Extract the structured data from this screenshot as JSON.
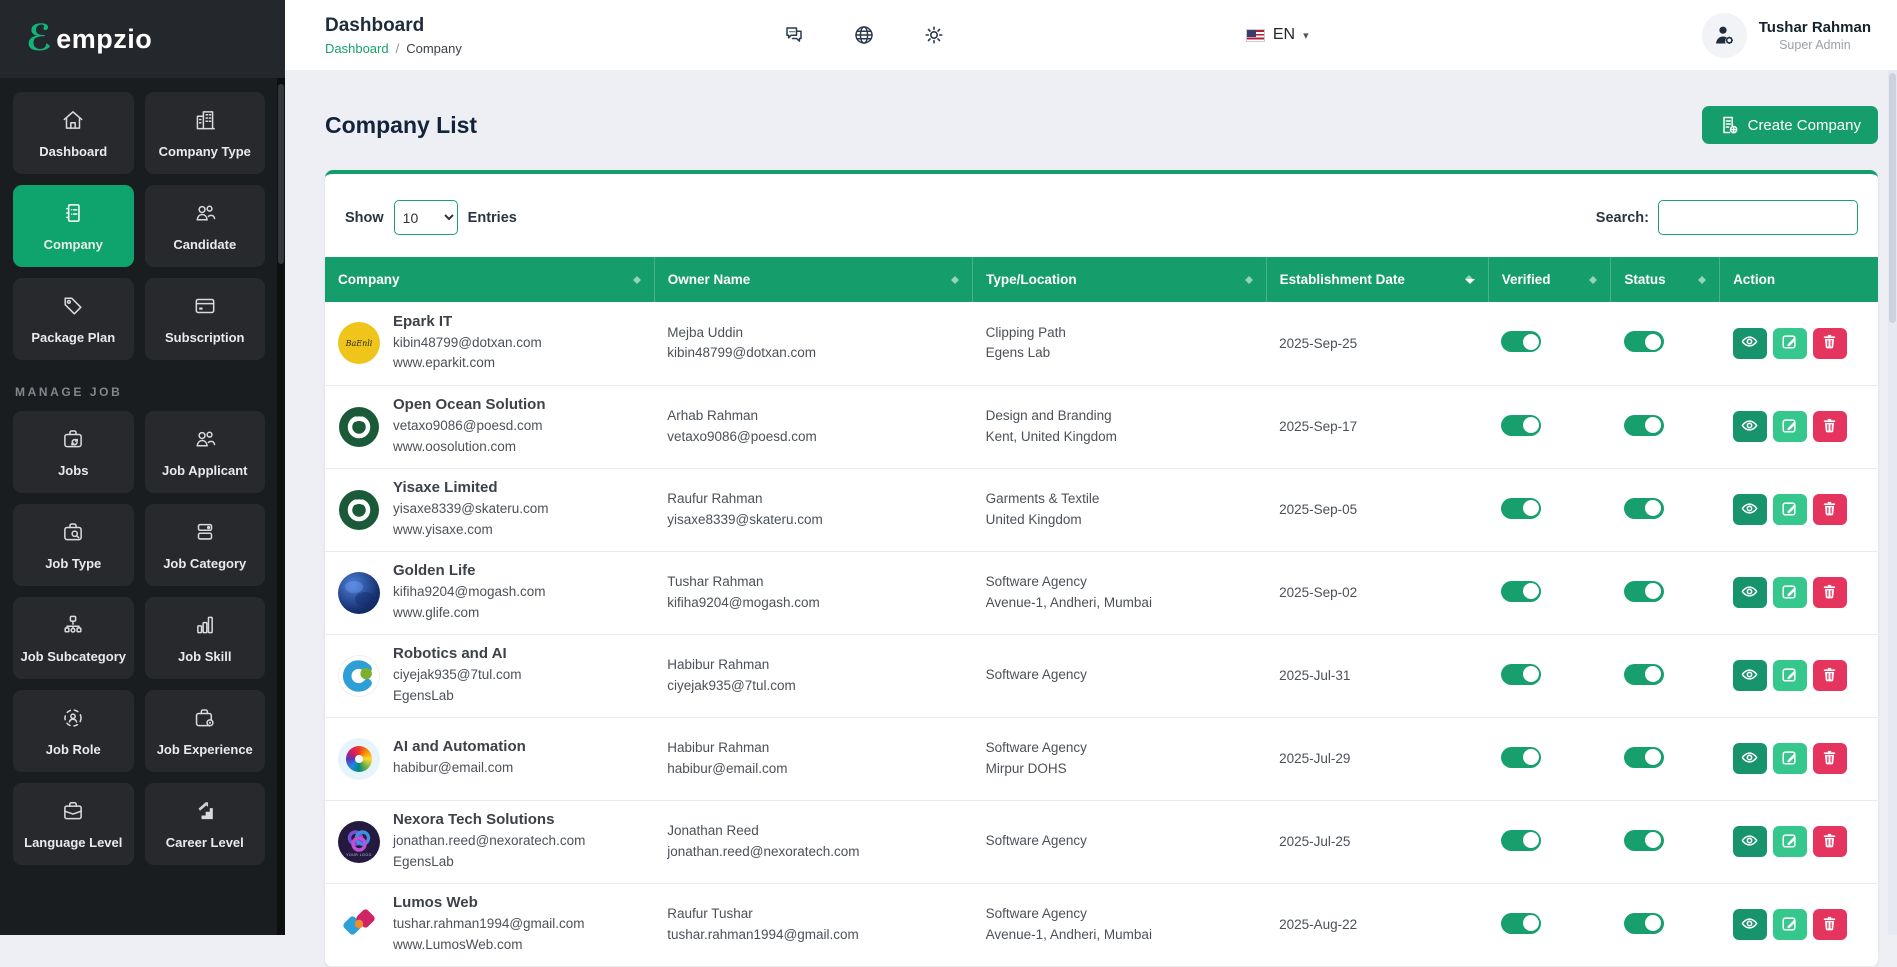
{
  "brand": {
    "logo_mark": "ℰ",
    "logo_text": "empzio"
  },
  "header": {
    "title": "Dashboard",
    "breadcrumb": [
      "Dashboard",
      "Company"
    ],
    "breadcrumb_separator": "/",
    "icons": [
      "chat-icon",
      "globe-icon",
      "gear-icon"
    ],
    "language": {
      "label": "EN",
      "flag": "us-flag-icon",
      "caret": "▾"
    },
    "user": {
      "name": "Tushar Rahman",
      "role": "Super Admin",
      "avatar_icon": "person-gear-icon"
    }
  },
  "sidebar": {
    "sections": [
      {
        "label": "",
        "items": [
          {
            "label": "Dashboard",
            "icon": "home",
            "active": false
          },
          {
            "label": "Company Type",
            "icon": "building",
            "active": false
          },
          {
            "label": "Company",
            "icon": "notebook",
            "active": true
          },
          {
            "label": "Candidate",
            "icon": "people",
            "active": false
          },
          {
            "label": "Package Plan",
            "icon": "tag",
            "active": false
          },
          {
            "label": "Subscription",
            "icon": "card",
            "active": false
          }
        ]
      },
      {
        "label": "MANAGE JOB",
        "items": [
          {
            "label": "Jobs",
            "icon": "briefcase-sync",
            "active": false
          },
          {
            "label": "Job Applicant",
            "icon": "people",
            "active": false
          },
          {
            "label": "Job Type",
            "icon": "briefcase-search",
            "active": false
          },
          {
            "label": "Job Category",
            "icon": "list-dot",
            "active": false
          },
          {
            "label": "Job Subcategory",
            "icon": "hierarchy",
            "active": false
          },
          {
            "label": "Job Skill",
            "icon": "bar-chart",
            "active": false
          },
          {
            "label": "Job Role",
            "icon": "person-orbit",
            "active": false
          },
          {
            "label": "Job Experience",
            "icon": "briefcase-gear",
            "active": false
          },
          {
            "label": "Language Level",
            "icon": "briefcase",
            "active": false
          },
          {
            "label": "Career Level",
            "icon": "stairs",
            "active": false
          }
        ]
      }
    ]
  },
  "page": {
    "title": "Company List",
    "create_button": "Create Company",
    "create_icon": "document-plus-icon"
  },
  "controls": {
    "show_label": "Show",
    "page_size": "10",
    "entries_label": "Entries",
    "search_label": "Search:",
    "search_value": ""
  },
  "table": {
    "columns": [
      {
        "label": "Company",
        "sortable": true,
        "sorted": ""
      },
      {
        "label": "Owner Name",
        "sortable": true,
        "sorted": ""
      },
      {
        "label": "Type/Location",
        "sortable": true,
        "sorted": ""
      },
      {
        "label": "Establishment Date",
        "sortable": true,
        "sorted": "desc"
      },
      {
        "label": "Verified",
        "sortable": true,
        "sorted": ""
      },
      {
        "label": "Status",
        "sortable": true,
        "sorted": ""
      },
      {
        "label": "Action",
        "sortable": false,
        "sorted": ""
      }
    ],
    "actions": [
      {
        "name": "view",
        "icon": "eye-icon"
      },
      {
        "name": "edit",
        "icon": "edit-icon"
      },
      {
        "name": "delete",
        "icon": "trash-icon"
      }
    ],
    "rows": [
      {
        "logo": "epark-gold-script",
        "company": "Epark IT",
        "email": "kibin48799@dotxan.com",
        "website": "www.eparkit.com",
        "owner_name": "Mejba Uddin",
        "owner_email": "kibin48799@dotxan.com",
        "type": "Clipping Path",
        "location": "Egens Lab",
        "date": "2025-Sep-25",
        "verified": true,
        "status": true
      },
      {
        "logo": "ring-emblem-green",
        "company": "Open Ocean Solution",
        "email": "vetaxo9086@poesd.com",
        "website": "www.oosolution.com",
        "owner_name": "Arhab Rahman",
        "owner_email": "vetaxo9086@poesd.com",
        "type": "Design and Branding",
        "location": "Kent, United Kingdom",
        "date": "2025-Sep-17",
        "verified": true,
        "status": true
      },
      {
        "logo": "ring-emblem-green",
        "company": "Yisaxe Limited",
        "email": "yisaxe8339@skateru.com",
        "website": "www.yisaxe.com",
        "owner_name": "Raufur Rahman",
        "owner_email": "yisaxe8339@skateru.com",
        "type": "Garments & Textile",
        "location": "United Kingdom",
        "date": "2025-Sep-05",
        "verified": true,
        "status": true
      },
      {
        "logo": "blue-planet",
        "company": "Golden Life",
        "email": "kifiha9204@mogash.com",
        "website": "www.glife.com",
        "owner_name": "Tushar Rahman",
        "owner_email": "kifiha9204@mogash.com",
        "type": "Software Agency",
        "location": "Avenue-1, Andheri, Mumbai",
        "date": "2025-Sep-02",
        "verified": true,
        "status": true
      },
      {
        "logo": "blue-c-green-dot",
        "company": "Robotics and AI",
        "email": "ciyejak935@7tul.com",
        "website": "EgensLab",
        "owner_name": "Habibur Rahman",
        "owner_email": "ciyejak935@7tul.com",
        "type": "Software Agency",
        "location": "",
        "date": "2025-Jul-31",
        "verified": true,
        "status": true
      },
      {
        "logo": "color-pinwheel",
        "company": "AI and Automation",
        "email": "habibur@email.com",
        "website": "",
        "owner_name": "Habibur Rahman",
        "owner_email": "habibur@email.com",
        "type": "Software Agency",
        "location": "Mirpur DOHS",
        "date": "2025-Jul-29",
        "verified": true,
        "status": true
      },
      {
        "logo": "nexora-purple",
        "company": "Nexora Tech Solutions",
        "email": "jonathan.reed@nexoratech.com",
        "website": "EgensLab",
        "owner_name": "Jonathan Reed",
        "owner_email": "jonathan.reed@nexoratech.com",
        "type": "Software Agency",
        "location": "",
        "date": "2025-Jul-25",
        "verified": true,
        "status": true
      },
      {
        "logo": "lumos-diamonds",
        "company": "Lumos Web",
        "email": "tushar.rahman1994@gmail.com",
        "website": "www.LumosWeb.com",
        "owner_name": "Raufur Tushar",
        "owner_email": "tushar.rahman1994@gmail.com",
        "type": "Software Agency",
        "location": "Avenue-1, Andheri, Mumbai",
        "date": "2025-Aug-22",
        "verified": true,
        "status": true
      }
    ]
  },
  "colors": {
    "accent_green": "#159d6b",
    "sidebar_active_green": "#0fa36e",
    "view_button_green": "#17946b",
    "edit_button_green": "#35c78c",
    "delete_button_red": "#e5345e",
    "toggle_on_green": "#17a06d",
    "sidebar_bg": "#1a1d20",
    "page_bg": "#edeff4"
  }
}
